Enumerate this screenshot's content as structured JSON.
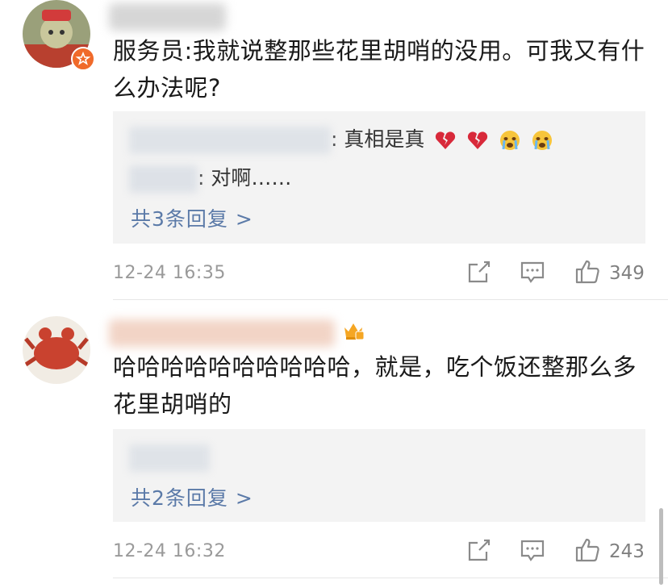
{
  "comments": [
    {
      "content": "服务员:我就说整那些花里胡哨的没用。可我又有什么办法呢?",
      "replies": [
        {
          "text": ": 真相是真"
        },
        {
          "text": ": 对啊……"
        }
      ],
      "more_replies": "共3条回复 >",
      "time": "12-24 16:35",
      "likes": "349"
    },
    {
      "content": "哈哈哈哈哈哈哈哈哈哈，就是，吃个饭还整那么多花里胡哨的",
      "more_replies": "共2条回复 >",
      "time": "12-24 16:32",
      "likes": "243"
    }
  ],
  "colors": {
    "link": "#5b7aa8",
    "meta": "#9a9a9a",
    "reply_bg": "#f3f3f3"
  }
}
